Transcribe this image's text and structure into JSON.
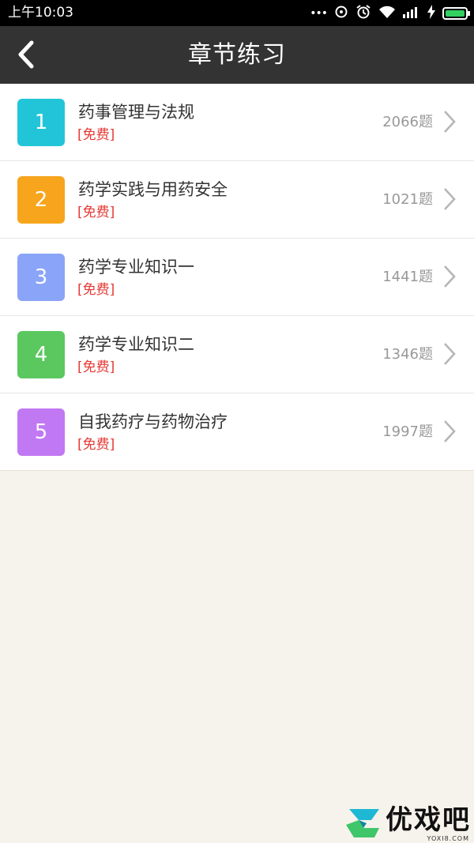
{
  "status_bar": {
    "time": "上午10:03",
    "dots": "•••",
    "icons": [
      "sync-icon",
      "alarm-icon",
      "wifi-icon",
      "signal-icon",
      "charging-icon",
      "battery-icon"
    ]
  },
  "header": {
    "title": "章节练习",
    "back_icon": "chevron-left-icon"
  },
  "chapters": [
    {
      "number": "1",
      "title": "药事管理与法规",
      "tag": "[免费]",
      "count": "2066题",
      "color": "#22c5d8"
    },
    {
      "number": "2",
      "title": "药学实践与用药安全",
      "tag": "[免费]",
      "count": "1021题",
      "color": "#f7a51c"
    },
    {
      "number": "3",
      "title": "药学专业知识一",
      "tag": "[免费]",
      "count": "1441题",
      "color": "#8aa4f8"
    },
    {
      "number": "4",
      "title": "药学专业知识二",
      "tag": "[免费]",
      "count": "1346题",
      "color": "#5ac85f"
    },
    {
      "number": "5",
      "title": "自我药疗与药物治疗",
      "tag": "[免费]",
      "count": "1997题",
      "color": "#c178f3"
    }
  ],
  "watermark": {
    "text": "优戏吧",
    "subtext": "YOXI8.COM"
  },
  "colors": {
    "header_bg": "#333333",
    "page_bg": "#f6f3ec",
    "tag": "#e53935",
    "count": "#999999"
  }
}
